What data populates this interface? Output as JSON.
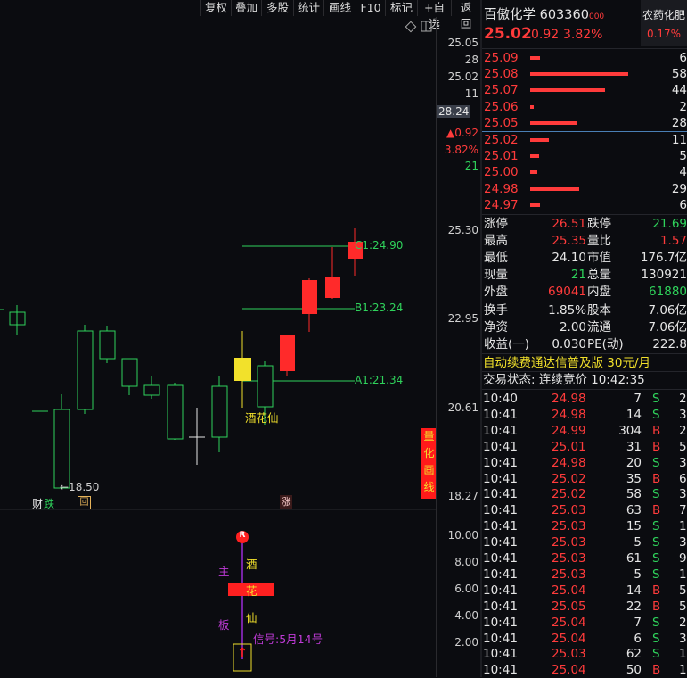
{
  "toolbar": {
    "buttons": [
      "复权",
      "叠加",
      "多股",
      "统计",
      "画线",
      "F10",
      "标记",
      "+自选",
      "返回"
    ]
  },
  "chart": {
    "axis_top": [
      "25.05",
      "28",
      "25.02",
      "11",
      "28.24",
      "▲0.92",
      "3.82%",
      "21"
    ],
    "axis_prices": [
      "25.30",
      "22.95",
      "20.61",
      "18.27"
    ],
    "indicator_ticks": [
      "10.00",
      "8.00",
      "6.00",
      "4.00",
      "2.00"
    ],
    "levels": {
      "c1": "C1:24.90",
      "b1": "B1:23.24",
      "a1": "A1:21.34"
    },
    "low_mark": "←18.50",
    "candle_label": "酒花仙",
    "side_label": [
      "量",
      "化",
      "画",
      "线"
    ],
    "badges": {
      "cai": "财",
      "die": "跌",
      "hui": "回",
      "zhang": "涨"
    },
    "indicator": {
      "r_badge": "R",
      "left_chars": [
        "主",
        "板"
      ],
      "mid_chars": [
        "酒",
        "花",
        "仙"
      ],
      "signal": "信号:5月14号",
      "arrow": "↑"
    }
  },
  "panel": {
    "name": "百傲化学",
    "code": "603360",
    "code_suffix": "000",
    "sector": "农药化肥",
    "sector_pct": "0.17%",
    "price": "25.02",
    "change": "0.92",
    "change_pct": "3.82%",
    "asks": [
      {
        "price": "25.09",
        "vol": "6",
        "bar": 0.06
      },
      {
        "price": "25.08",
        "vol": "58",
        "bar": 0.58
      },
      {
        "price": "25.07",
        "vol": "44",
        "bar": 0.44
      },
      {
        "price": "25.06",
        "vol": "2",
        "bar": 0.02
      },
      {
        "price": "25.05",
        "vol": "28",
        "bar": 0.28
      }
    ],
    "bids": [
      {
        "price": "25.02",
        "vol": "11",
        "bar": 0.11
      },
      {
        "price": "25.01",
        "vol": "5",
        "bar": 0.05
      },
      {
        "price": "25.00",
        "vol": "4",
        "bar": 0.04
      },
      {
        "price": "24.98",
        "vol": "29",
        "bar": 0.29
      },
      {
        "price": "24.97",
        "vol": "6",
        "bar": 0.06
      }
    ],
    "stats": [
      {
        "l1": "涨停",
        "v1": "26.51",
        "c1": "red",
        "l2": "跌停",
        "v2": "21.69",
        "c2": "grn"
      },
      {
        "l1": "最高",
        "v1": "25.35",
        "c1": "red",
        "l2": "量比",
        "v2": "1.57",
        "c2": "red"
      },
      {
        "l1": "最低",
        "v1": "24.10",
        "c1": "wht",
        "l2": "市值",
        "v2": "176.7亿",
        "c2": "wht"
      },
      {
        "l1": "现量",
        "v1": "21",
        "c1": "grn",
        "l2": "总量",
        "v2": "130921",
        "c2": "wht"
      },
      {
        "l1": "外盘",
        "v1": "69041",
        "c1": "red",
        "l2": "内盘",
        "v2": "61880",
        "c2": "grn"
      }
    ],
    "stats2": [
      {
        "l1": "换手",
        "v1": "1.85%",
        "l2": "股本",
        "v2": "7.06亿"
      },
      {
        "l1": "净资",
        "v1": "2.00",
        "l2": "流通",
        "v2": "7.06亿"
      },
      {
        "l1": "收益(一)",
        "v1": "0.030",
        "l2": "PE(动)",
        "v2": "222.8"
      }
    ],
    "promo": "自动续费通达信普及版  30元/月",
    "trade_status": "交易状态: 连续竞价  10:42:35",
    "ticks": [
      {
        "t": "10:40",
        "p": "24.98",
        "v": "7",
        "s": "S",
        "r": "2"
      },
      {
        "t": "10:41",
        "p": "24.98",
        "v": "14",
        "s": "S",
        "r": "3"
      },
      {
        "t": "10:41",
        "p": "24.99",
        "v": "304",
        "s": "B",
        "r": "28"
      },
      {
        "t": "10:41",
        "p": "25.01",
        "v": "31",
        "s": "B",
        "r": "5"
      },
      {
        "t": "10:41",
        "p": "24.98",
        "v": "20",
        "s": "S",
        "r": "3"
      },
      {
        "t": "10:41",
        "p": "25.02",
        "v": "35",
        "s": "B",
        "r": "6"
      },
      {
        "t": "10:41",
        "p": "25.02",
        "v": "58",
        "s": "S",
        "r": "3"
      },
      {
        "t": "10:41",
        "p": "25.03",
        "v": "63",
        "s": "B",
        "r": "7"
      },
      {
        "t": "10:41",
        "p": "25.03",
        "v": "15",
        "s": "S",
        "r": "1"
      },
      {
        "t": "10:41",
        "p": "25.03",
        "v": "5",
        "s": "S",
        "r": "3"
      },
      {
        "t": "10:41",
        "p": "25.03",
        "v": "61",
        "s": "S",
        "r": "9"
      },
      {
        "t": "10:41",
        "p": "25.03",
        "v": "5",
        "s": "S",
        "r": "1"
      },
      {
        "t": "10:41",
        "p": "25.04",
        "v": "14",
        "s": "B",
        "r": "5"
      },
      {
        "t": "10:41",
        "p": "25.05",
        "v": "22",
        "s": "B",
        "r": "5"
      },
      {
        "t": "10:41",
        "p": "25.04",
        "v": "7",
        "s": "S",
        "r": "2"
      },
      {
        "t": "10:41",
        "p": "25.04",
        "v": "6",
        "s": "S",
        "r": "3"
      },
      {
        "t": "10:41",
        "p": "25.03",
        "v": "62",
        "s": "S",
        "r": "13"
      },
      {
        "t": "10:41",
        "p": "25.04",
        "v": "50",
        "s": "B",
        "r": "12"
      }
    ]
  }
}
